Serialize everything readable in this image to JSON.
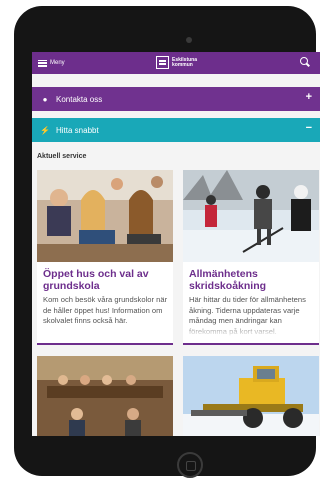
{
  "header": {
    "menu_label": "Meny",
    "logo_line1": "Eskilstuna",
    "logo_line2": "kommun"
  },
  "accordion": {
    "contact": {
      "label": "Kontakta oss",
      "sign": "+"
    },
    "quick": {
      "label": "Hitta snabbt",
      "sign": "−"
    }
  },
  "section_title": "Aktuell service",
  "cards": [
    {
      "title": "Öppet hus och val av grundskola",
      "text": "Kom och besök våra grundskolor när de håller öppet hus! Information om skolvalet finns också här."
    },
    {
      "title": "Allmänhetens skridskoåkning",
      "text": "Här hittar du tider för allmänhetens åkning. Tiderna uppdateras varje måndag men ändringar kan förekomma på kort varsel."
    }
  ],
  "colors": {
    "brand": "#6d2e8c",
    "accent": "#19a8b8"
  },
  "icons": {
    "menu": "hamburger-icon",
    "search": "search-icon",
    "contact": "chat-bubble-icon",
    "quick": "lightning-icon"
  }
}
